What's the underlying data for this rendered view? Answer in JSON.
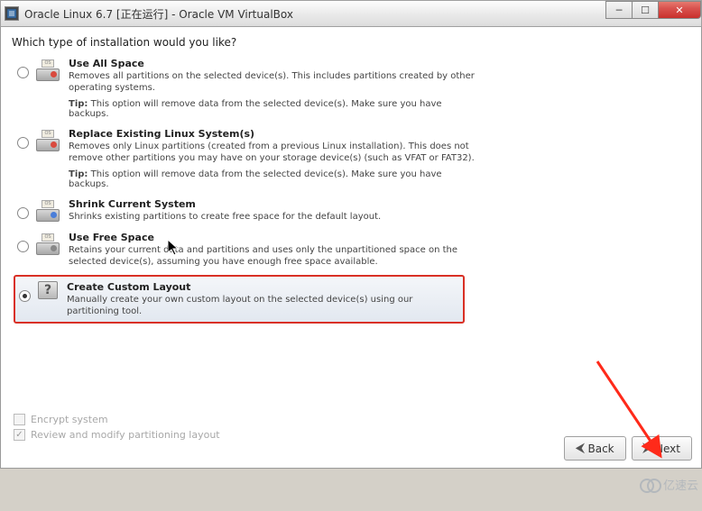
{
  "window": {
    "title": "Oracle Linux 6.7 [正在运行] - Oracle VM VirtualBox"
  },
  "installer": {
    "prompt": "Which type of installation would you like?",
    "options": [
      {
        "id": "use-all-space",
        "title": "Use All Space",
        "desc": "Removes all partitions on the selected device(s).  This includes partitions created by other operating systems.",
        "tip_label": "Tip:",
        "tip": "This option will remove data from the selected device(s).  Make sure you have backups.",
        "selected": false,
        "icon_accent": "red"
      },
      {
        "id": "replace-linux",
        "title": "Replace Existing Linux System(s)",
        "desc": "Removes only Linux partitions (created from a previous Linux installation).  This does not remove other partitions you may have on your storage device(s) (such as VFAT or FAT32).",
        "tip_label": "Tip:",
        "tip": "This option will remove data from the selected device(s).  Make sure you have backups.",
        "selected": false,
        "icon_accent": "red"
      },
      {
        "id": "shrink",
        "title": "Shrink Current System",
        "desc": "Shrinks existing partitions to create free space for the default layout.",
        "tip_label": "",
        "tip": "",
        "selected": false,
        "icon_accent": "blue"
      },
      {
        "id": "use-free-space",
        "title": "Use Free Space",
        "desc": "Retains your current data and partitions and uses only the unpartitioned space on the selected device(s), assuming you have enough free space available.",
        "tip_label": "",
        "tip": "",
        "selected": false,
        "icon_accent": "gray"
      },
      {
        "id": "custom-layout",
        "title": "Create Custom Layout",
        "desc": "Manually create your own custom layout on the selected device(s) using our partitioning tool.",
        "tip_label": "",
        "tip": "",
        "selected": true,
        "icon_accent": "qmark"
      }
    ],
    "checks": {
      "encrypt": {
        "label": "Encrypt system",
        "checked": false
      },
      "review": {
        "label": "Review and modify partitioning layout",
        "checked": true
      }
    },
    "nav": {
      "back": "Back",
      "next": "Next"
    }
  },
  "watermark": "亿速云"
}
